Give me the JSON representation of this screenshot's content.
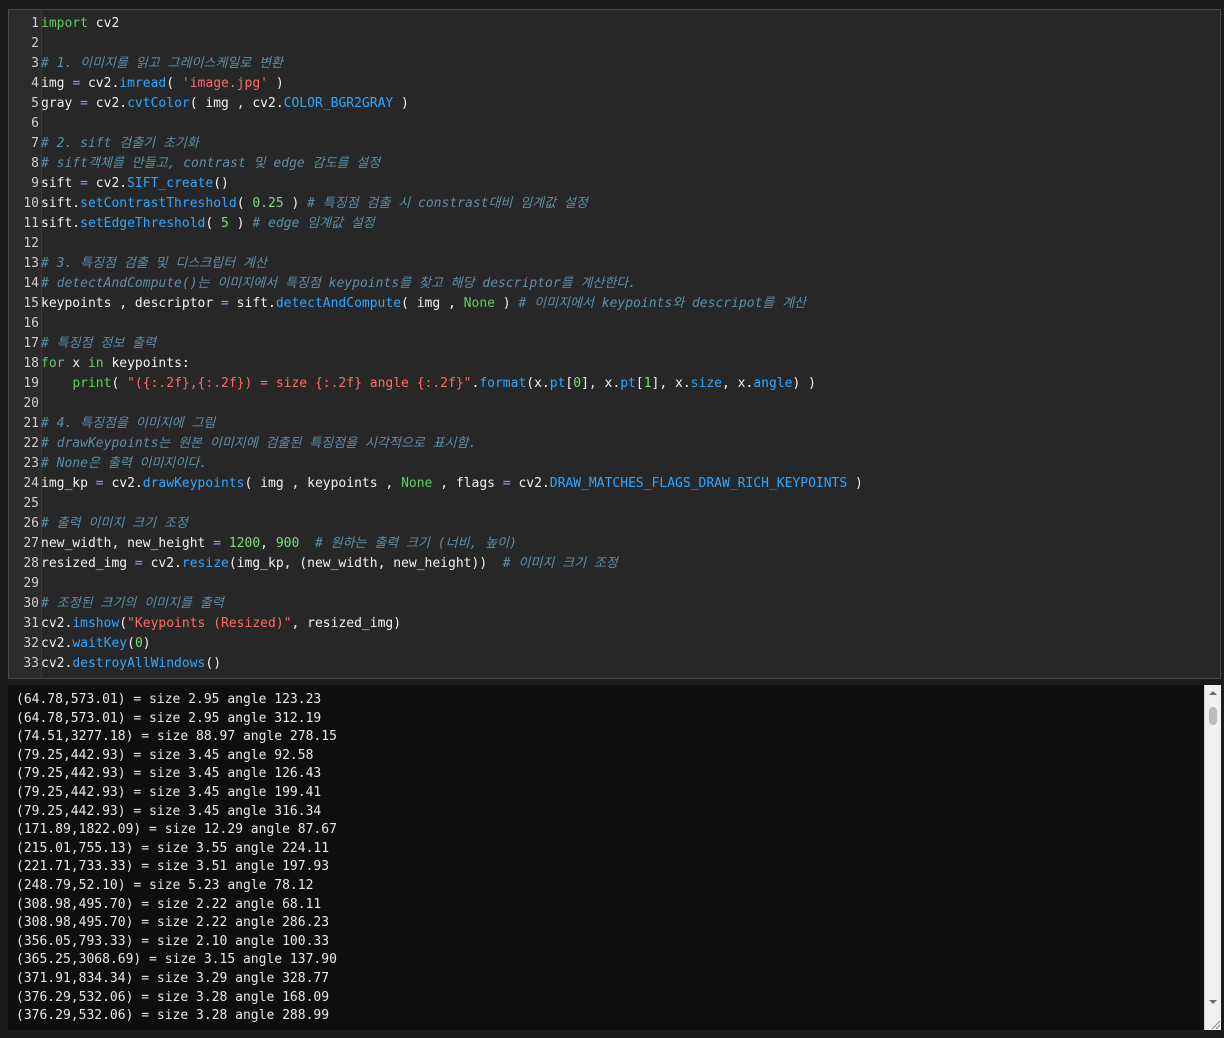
{
  "editor": {
    "lines": [
      {
        "n": "1",
        "tokens": [
          {
            "t": "import",
            "c": "kw"
          },
          {
            "t": " cv2",
            "c": ""
          }
        ]
      },
      {
        "n": "2",
        "tokens": []
      },
      {
        "n": "3",
        "tokens": [
          {
            "t": "# 1. 이미지를 읽고 그레이스케일로 변환",
            "c": "cmt"
          }
        ]
      },
      {
        "n": "4",
        "tokens": [
          {
            "t": "img ",
            "c": ""
          },
          {
            "t": "=",
            "c": "op"
          },
          {
            "t": " cv2.",
            "c": ""
          },
          {
            "t": "imread",
            "c": "attr"
          },
          {
            "t": "( ",
            "c": ""
          },
          {
            "t": "'image.jpg'",
            "c": "str"
          },
          {
            "t": " )",
            "c": ""
          }
        ]
      },
      {
        "n": "5",
        "tokens": [
          {
            "t": "gray ",
            "c": ""
          },
          {
            "t": "=",
            "c": "op"
          },
          {
            "t": " cv2.",
            "c": ""
          },
          {
            "t": "cvtColor",
            "c": "attr"
          },
          {
            "t": "( img , cv2.",
            "c": ""
          },
          {
            "t": "COLOR_BGR2GRAY",
            "c": "attr"
          },
          {
            "t": " )",
            "c": ""
          }
        ]
      },
      {
        "n": "6",
        "tokens": []
      },
      {
        "n": "7",
        "tokens": [
          {
            "t": "# 2. sift 검출기 초기화",
            "c": "cmt"
          }
        ]
      },
      {
        "n": "8",
        "tokens": [
          {
            "t": "# sift객체를 만들고, contrast 및 edge 감도를 설정",
            "c": "cmt"
          }
        ]
      },
      {
        "n": "9",
        "tokens": [
          {
            "t": "sift ",
            "c": ""
          },
          {
            "t": "=",
            "c": "op"
          },
          {
            "t": " cv2.",
            "c": ""
          },
          {
            "t": "SIFT_create",
            "c": "attr"
          },
          {
            "t": "()",
            "c": ""
          }
        ]
      },
      {
        "n": "10",
        "tokens": [
          {
            "t": "sift.",
            "c": ""
          },
          {
            "t": "setContrastThreshold",
            "c": "attr"
          },
          {
            "t": "( ",
            "c": ""
          },
          {
            "t": "0.25",
            "c": "num"
          },
          {
            "t": " ) ",
            "c": ""
          },
          {
            "t": "# 특징점 검출 시 constrast대비 임계값 설정",
            "c": "cmt"
          }
        ]
      },
      {
        "n": "11",
        "tokens": [
          {
            "t": "sift.",
            "c": ""
          },
          {
            "t": "setEdgeThreshold",
            "c": "attr"
          },
          {
            "t": "( ",
            "c": ""
          },
          {
            "t": "5",
            "c": "num"
          },
          {
            "t": " ) ",
            "c": ""
          },
          {
            "t": "# edge 임계값 설정",
            "c": "cmt"
          }
        ]
      },
      {
        "n": "12",
        "tokens": []
      },
      {
        "n": "13",
        "tokens": [
          {
            "t": "# 3. 특징점 검출 및 디스크립터 계산",
            "c": "cmt"
          }
        ]
      },
      {
        "n": "14",
        "tokens": [
          {
            "t": "# detectAndCompute()는 이미지에서 특징점 keypoints를 찾고 해당 descriptor를 계산한다.",
            "c": "cmt"
          }
        ]
      },
      {
        "n": "15",
        "tokens": [
          {
            "t": "keypoints , descriptor ",
            "c": ""
          },
          {
            "t": "=",
            "c": "op"
          },
          {
            "t": " sift.",
            "c": ""
          },
          {
            "t": "detectAndCompute",
            "c": "attr"
          },
          {
            "t": "( img , ",
            "c": ""
          },
          {
            "t": "None",
            "c": "kw"
          },
          {
            "t": " ) ",
            "c": ""
          },
          {
            "t": "# 이미지에서 keypoints와 descripot를 계산",
            "c": "cmt"
          }
        ]
      },
      {
        "n": "16",
        "tokens": []
      },
      {
        "n": "17",
        "tokens": [
          {
            "t": "# 특징점 정보 출력",
            "c": "cmt"
          }
        ]
      },
      {
        "n": "18",
        "tokens": [
          {
            "t": "for",
            "c": "kw"
          },
          {
            "t": " x ",
            "c": ""
          },
          {
            "t": "in",
            "c": "kw"
          },
          {
            "t": " keypoints:",
            "c": ""
          }
        ]
      },
      {
        "n": "19",
        "tokens": [
          {
            "t": "    ",
            "c": ""
          },
          {
            "t": "print",
            "c": "kw"
          },
          {
            "t": "( ",
            "c": ""
          },
          {
            "t": "\"({:.2f},{:.2f}) = size {:.2f} angle {:.2f}\"",
            "c": "str"
          },
          {
            "t": ".",
            "c": ""
          },
          {
            "t": "format",
            "c": "attr"
          },
          {
            "t": "(x.",
            "c": ""
          },
          {
            "t": "pt",
            "c": "attr"
          },
          {
            "t": "[",
            "c": ""
          },
          {
            "t": "0",
            "c": "num"
          },
          {
            "t": "], x.",
            "c": ""
          },
          {
            "t": "pt",
            "c": "attr"
          },
          {
            "t": "[",
            "c": ""
          },
          {
            "t": "1",
            "c": "num"
          },
          {
            "t": "], x.",
            "c": ""
          },
          {
            "t": "size",
            "c": "attr"
          },
          {
            "t": ", x.",
            "c": ""
          },
          {
            "t": "angle",
            "c": "attr"
          },
          {
            "t": ") )",
            "c": ""
          }
        ]
      },
      {
        "n": "20",
        "tokens": []
      },
      {
        "n": "21",
        "tokens": [
          {
            "t": "# 4. 특징점을 이미지에 그림",
            "c": "cmt"
          }
        ]
      },
      {
        "n": "22",
        "tokens": [
          {
            "t": "# drawKeypoints는 원본 이미지에 검출된 특징점을 시각적으로 표시함.",
            "c": "cmt"
          }
        ]
      },
      {
        "n": "23",
        "tokens": [
          {
            "t": "# None은 출력 이미지이다.",
            "c": "cmt"
          }
        ]
      },
      {
        "n": "24",
        "tokens": [
          {
            "t": "img_kp ",
            "c": ""
          },
          {
            "t": "=",
            "c": "op"
          },
          {
            "t": " cv2.",
            "c": ""
          },
          {
            "t": "drawKeypoints",
            "c": "attr"
          },
          {
            "t": "( img , keypoints , ",
            "c": ""
          },
          {
            "t": "None",
            "c": "kw"
          },
          {
            "t": " , flags ",
            "c": ""
          },
          {
            "t": "=",
            "c": "op"
          },
          {
            "t": " cv2.",
            "c": ""
          },
          {
            "t": "DRAW_MATCHES_FLAGS_DRAW_RICH_KEYPOINTS",
            "c": "attr"
          },
          {
            "t": " )",
            "c": ""
          }
        ]
      },
      {
        "n": "25",
        "tokens": []
      },
      {
        "n": "26",
        "tokens": [
          {
            "t": "# 출력 이미지 크기 조정",
            "c": "cmt"
          }
        ]
      },
      {
        "n": "27",
        "tokens": [
          {
            "t": "new_width, new_height ",
            "c": ""
          },
          {
            "t": "=",
            "c": "op"
          },
          {
            "t": " ",
            "c": ""
          },
          {
            "t": "1200",
            "c": "num"
          },
          {
            "t": ", ",
            "c": ""
          },
          {
            "t": "900",
            "c": "num"
          },
          {
            "t": "  ",
            "c": ""
          },
          {
            "t": "# 원하는 출력 크기 (너비, 높이)",
            "c": "cmt"
          }
        ]
      },
      {
        "n": "28",
        "tokens": [
          {
            "t": "resized_img ",
            "c": ""
          },
          {
            "t": "=",
            "c": "op"
          },
          {
            "t": " cv2.",
            "c": ""
          },
          {
            "t": "resize",
            "c": "attr"
          },
          {
            "t": "(img_kp, (new_width, new_height))  ",
            "c": ""
          },
          {
            "t": "# 이미지 크기 조정",
            "c": "cmt"
          }
        ]
      },
      {
        "n": "29",
        "tokens": []
      },
      {
        "n": "30",
        "tokens": [
          {
            "t": "# 조정된 크기의 이미지를 출력",
            "c": "cmt"
          }
        ]
      },
      {
        "n": "31",
        "tokens": [
          {
            "t": "cv2.",
            "c": ""
          },
          {
            "t": "imshow",
            "c": "attr"
          },
          {
            "t": "(",
            "c": ""
          },
          {
            "t": "\"Keypoints (Resized)\"",
            "c": "str"
          },
          {
            "t": ", resized_img)",
            "c": ""
          }
        ]
      },
      {
        "n": "32",
        "tokens": [
          {
            "t": "cv2.",
            "c": ""
          },
          {
            "t": "waitKey",
            "c": "attr"
          },
          {
            "t": "(",
            "c": ""
          },
          {
            "t": "0",
            "c": "num"
          },
          {
            "t": ")",
            "c": ""
          }
        ]
      },
      {
        "n": "33",
        "tokens": [
          {
            "t": "cv2.",
            "c": ""
          },
          {
            "t": "destroyAllWindows",
            "c": "attr"
          },
          {
            "t": "()",
            "c": ""
          }
        ]
      }
    ]
  },
  "output": {
    "lines": [
      "(64.78,573.01) = size 2.95 angle 123.23",
      "(64.78,573.01) = size 2.95 angle 312.19",
      "(74.51,3277.18) = size 88.97 angle 278.15",
      "(79.25,442.93) = size 3.45 angle 92.58",
      "(79.25,442.93) = size 3.45 angle 126.43",
      "(79.25,442.93) = size 3.45 angle 199.41",
      "(79.25,442.93) = size 3.45 angle 316.34",
      "(171.89,1822.09) = size 12.29 angle 87.67",
      "(215.01,755.13) = size 3.55 angle 224.11",
      "(221.71,733.33) = size 3.51 angle 197.93",
      "(248.79,52.10) = size 5.23 angle 78.12",
      "(308.98,495.70) = size 2.22 angle 68.11",
      "(308.98,495.70) = size 2.22 angle 286.23",
      "(356.05,793.33) = size 2.10 angle 100.33",
      "(365.25,3068.69) = size 3.15 angle 137.90",
      "(371.91,834.34) = size 3.29 angle 328.77",
      "(376.29,532.06) = size 3.28 angle 168.09",
      "(376.29,532.06) = size 3.28 angle 288.99"
    ]
  },
  "icons": {
    "scroll_up": "chevron-up-icon",
    "scroll_down": "chevron-down-icon",
    "resize": "resize-grip-icon"
  }
}
